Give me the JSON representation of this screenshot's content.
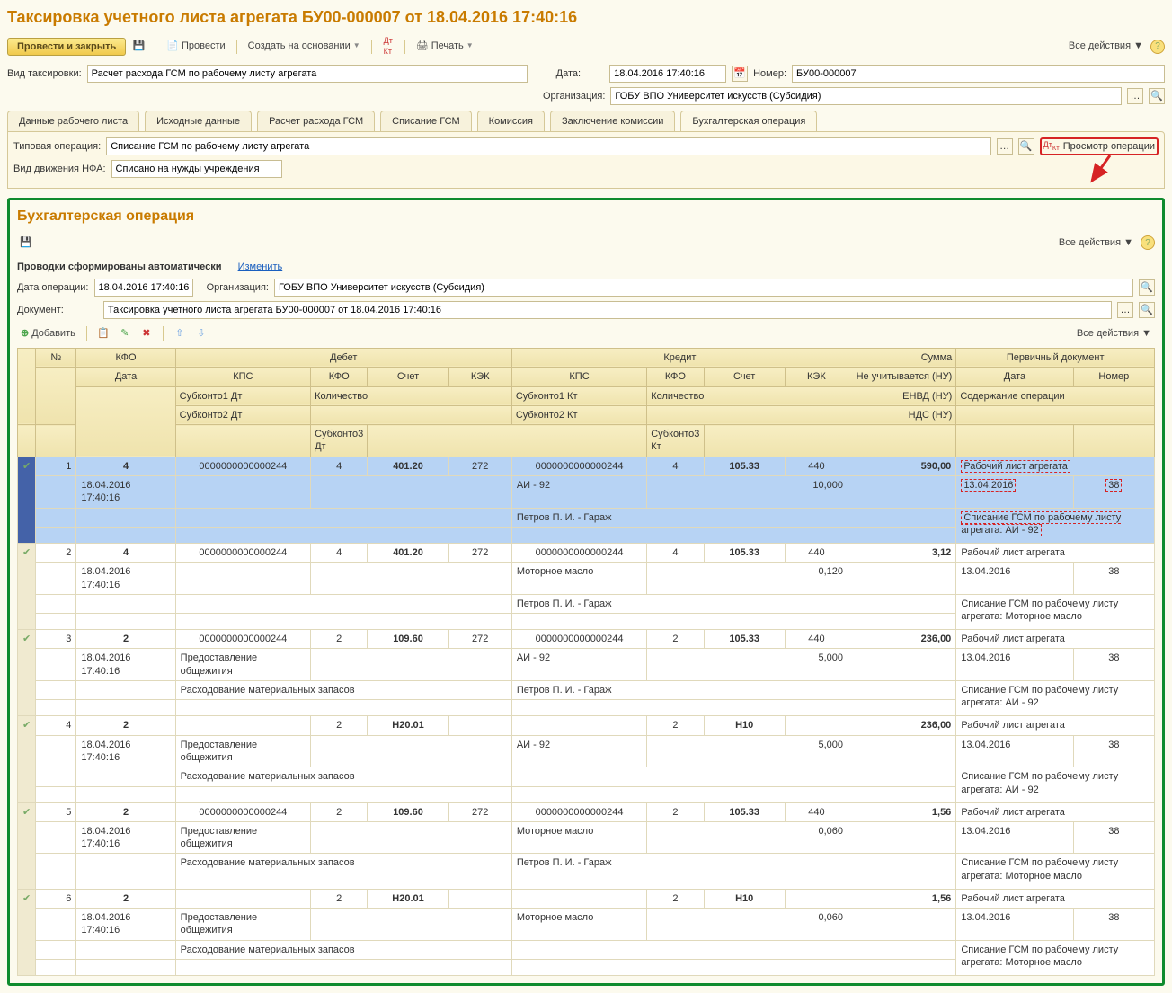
{
  "title": "Таксировка учетного листа агрегата БУ00-000007 от 18.04.2016 17:40:16",
  "toolbar": {
    "submit_close": "Провести и закрыть",
    "submit": "Провести",
    "create_based": "Создать на основании",
    "print": "Печать",
    "all_actions": "Все действия"
  },
  "fields": {
    "tax_type_label": "Вид таксировки:",
    "tax_type_value": "Расчет расхода ГСМ по рабочему листу агрегата",
    "date_label": "Дата:",
    "date_value": "18.04.2016 17:40:16",
    "number_label": "Номер:",
    "number_value": "БУ00-000007",
    "org_label": "Организация:",
    "org_value": "ГОБУ ВПО Университет искусств (Субсидия)"
  },
  "tabs": [
    "Данные рабочего листа",
    "Исходные данные",
    "Расчет расхода ГСМ",
    "Списание ГСМ",
    "Комиссия",
    "Заключение комиссии",
    "Бухгалтерская операция"
  ],
  "active_tab": 6,
  "tab_content": {
    "type_op_label": "Типовая операция:",
    "type_op_value": "Списание ГСМ по рабочему листу агрегата",
    "move_label": "Вид движения НФА:",
    "move_value": "Списано на нужды учреждения",
    "view_op_btn": "Просмотр операции"
  },
  "op": {
    "title": "Бухгалтерская операция",
    "auto_label": "Проводки сформированы автоматически",
    "change_link": "Изменить",
    "op_date_label": "Дата операции:",
    "op_date_value": "18.04.2016 17:40:16",
    "org_label": "Организация:",
    "org_value": "ГОБУ ВПО Университет искусств (Субсидия)",
    "doc_label": "Документ:",
    "doc_value": "Таксировка учетного листа агрегата БУ00-000007 от 18.04.2016 17:40:16",
    "add_btn": "Добавить",
    "all_actions": "Все действия"
  },
  "headers": {
    "n": "№",
    "kfo": "КФО",
    "debit": "Дебет",
    "credit": "Кредит",
    "sum": "Сумма",
    "prim": "Первичный документ",
    "date": "Дата",
    "kps": "КПС",
    "account": "Счет",
    "kek": "КЭК",
    "qty": "Количество",
    "notax": "Не учитывается (НУ)",
    "envd": "ЕНВД (НУ)",
    "nds": "НДС (НУ)",
    "number": "Номер",
    "content": "Содержание операции",
    "s1d": "Субконто1 Дт",
    "s2d": "Субконто2 Дт",
    "s3d": "Субконто3 Дт",
    "s1k": "Субконто1 Кт",
    "s2k": "Субконто2 Кт",
    "s3k": "Субконто3 Кт"
  },
  "rows": [
    {
      "n": 1,
      "sel": true,
      "kfo": "4",
      "date": "18.04.2016 17:40:16",
      "d_kps": "0000000000000244",
      "d_kfo": "4",
      "d_acc": "401.20",
      "d_kek": "272",
      "k_kps": "0000000000000244",
      "k_kfo": "4",
      "k_acc": "105.33",
      "k_kek": "440",
      "k_qty": "10,000",
      "k_s1": "АИ - 92",
      "k_s2": "Петров П. И. - Гараж",
      "sum": "590,00",
      "prim": "Рабочий лист агрегата",
      "p_date": "13.04.2016",
      "p_num": "38",
      "content": "Списание ГСМ по рабочему листу агрегата: АИ - 92",
      "hl": true
    },
    {
      "n": 2,
      "kfo": "4",
      "date": "18.04.2016 17:40:16",
      "d_kps": "0000000000000244",
      "d_kfo": "4",
      "d_acc": "401.20",
      "d_kek": "272",
      "k_kps": "0000000000000244",
      "k_kfo": "4",
      "k_acc": "105.33",
      "k_kek": "440",
      "k_qty": "0,120",
      "k_s1": "Моторное масло",
      "k_s2": "Петров П. И. - Гараж",
      "sum": "3,12",
      "prim": "Рабочий лист агрегата",
      "p_date": "13.04.2016",
      "p_num": "38",
      "content": "Списание ГСМ по рабочему листу агрегата: Моторное масло"
    },
    {
      "n": 3,
      "kfo": "2",
      "date": "18.04.2016 17:40:16",
      "d_kps": "0000000000000244",
      "d_kfo": "2",
      "d_acc": "109.60",
      "d_kek": "272",
      "d_s1": "Предоставление общежития",
      "d_s2": "Расходование материальных запасов",
      "k_kps": "0000000000000244",
      "k_kfo": "2",
      "k_acc": "105.33",
      "k_kek": "440",
      "k_qty": "5,000",
      "k_s1": "АИ - 92",
      "k_s2": "Петров П. И. - Гараж",
      "sum": "236,00",
      "prim": "Рабочий лист агрегата",
      "p_date": "13.04.2016",
      "p_num": "38",
      "content": "Списание ГСМ по рабочему листу агрегата: АИ - 92"
    },
    {
      "n": 4,
      "kfo": "2",
      "date": "18.04.2016 17:40:16",
      "d_kfo": "2",
      "d_acc": "Н20.01",
      "d_s1": "Предоставление общежития",
      "d_s2": "Расходование материальных запасов",
      "k_kfo": "2",
      "k_acc": "Н10",
      "k_qty": "5,000",
      "k_s1": "АИ - 92",
      "sum": "236,00",
      "prim": "Рабочий лист агрегата",
      "p_date": "13.04.2016",
      "p_num": "38",
      "content": "Списание ГСМ по рабочему листу агрегата: АИ - 92"
    },
    {
      "n": 5,
      "kfo": "2",
      "date": "18.04.2016 17:40:16",
      "d_kps": "0000000000000244",
      "d_kfo": "2",
      "d_acc": "109.60",
      "d_kek": "272",
      "d_s1": "Предоставление общежития",
      "d_s2": "Расходование материальных запасов",
      "k_kps": "0000000000000244",
      "k_kfo": "2",
      "k_acc": "105.33",
      "k_kek": "440",
      "k_qty": "0,060",
      "k_s1": "Моторное масло",
      "k_s2": "Петров П. И. - Гараж",
      "sum": "1,56",
      "prim": "Рабочий лист агрегата",
      "p_date": "13.04.2016",
      "p_num": "38",
      "content": "Списание ГСМ по рабочему листу агрегата: Моторное масло"
    },
    {
      "n": 6,
      "kfo": "2",
      "date": "18.04.2016 17:40:16",
      "d_kfo": "2",
      "d_acc": "Н20.01",
      "d_s1": "Предоставление общежития",
      "d_s2": "Расходование материальных запасов",
      "k_kfo": "2",
      "k_acc": "Н10",
      "k_qty": "0,060",
      "k_s1": "Моторное масло",
      "sum": "1,56",
      "prim": "Рабочий лист агрегата",
      "p_date": "13.04.2016",
      "p_num": "38",
      "content": "Списание ГСМ по рабочему листу агрегата: Моторное масло"
    }
  ]
}
